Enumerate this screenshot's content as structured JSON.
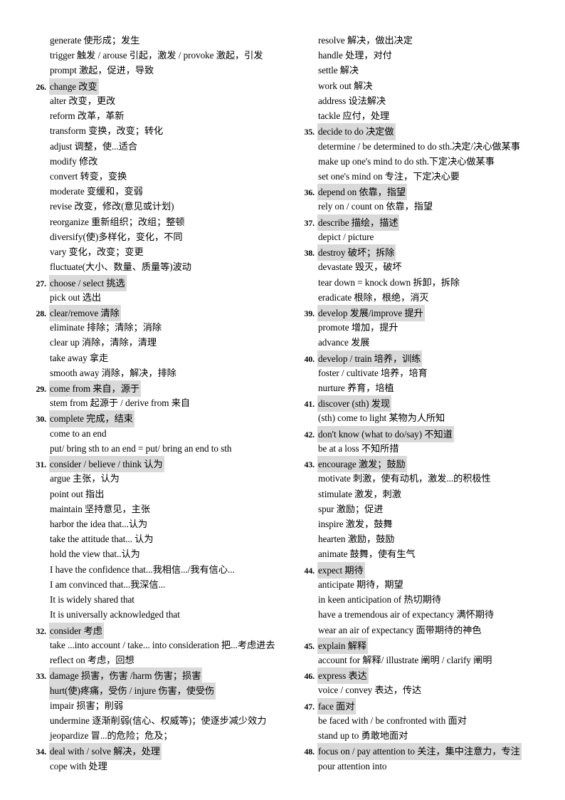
{
  "document": {
    "title": "English Synonym Expressions Vocabulary List",
    "highlight_color": "#d9d9d9",
    "text_color": "#000000",
    "background_color": "#ffffff"
  },
  "left_column": [
    {
      "num": "",
      "text": "generate 使形成；发生",
      "highlight": false
    },
    {
      "num": "",
      "text": "trigger 触发 / arouse 引起，激发 / provoke 激起，引发",
      "highlight": false
    },
    {
      "num": "",
      "text": "prompt 激起，促进，导致",
      "highlight": false
    },
    {
      "num": "26.",
      "text": "change 改变",
      "highlight": true
    },
    {
      "num": "",
      "text": "alter 改变，更改",
      "highlight": false
    },
    {
      "num": "",
      "text": "reform 改革，革新",
      "highlight": false
    },
    {
      "num": "",
      "text": "transform 变换，改变；转化",
      "highlight": false
    },
    {
      "num": "",
      "text": "adjust 调整，使...适合",
      "highlight": false
    },
    {
      "num": "",
      "text": "modify 修改",
      "highlight": false
    },
    {
      "num": "",
      "text": "convert 转变，变换",
      "highlight": false
    },
    {
      "num": "",
      "text": "moderate 变缓和，变弱",
      "highlight": false
    },
    {
      "num": "",
      "text": "revise 改变，修改(意见或计划)",
      "highlight": false
    },
    {
      "num": "",
      "text": "reorganize 重新组织；改组；整顿",
      "highlight": false
    },
    {
      "num": "",
      "text": "diversify(使)多样化，变化，不同",
      "highlight": false
    },
    {
      "num": "",
      "text": "vary 变化，改变；变更",
      "highlight": false
    },
    {
      "num": "",
      "text": "fluctuate(大小、数量、质量等)波动",
      "highlight": false
    },
    {
      "num": "27.",
      "text": "choose / select  挑选",
      "highlight": true
    },
    {
      "num": "",
      "text": "pick out 选出",
      "highlight": false
    },
    {
      "num": "28.",
      "text": "clear/remove 清除",
      "highlight": true
    },
    {
      "num": "",
      "text": "eliminate 排除；清除；消除",
      "highlight": false
    },
    {
      "num": "",
      "text": "clear up 消除，清除，清理",
      "highlight": false
    },
    {
      "num": "",
      "text": "take away 拿走",
      "highlight": false
    },
    {
      "num": "",
      "text": "smooth away 消除，解决，排除",
      "highlight": false
    },
    {
      "num": "29.",
      "text": "come from  来自，源于",
      "highlight": true
    },
    {
      "num": "",
      "text": "stem from 起源于 / derive from 来自",
      "highlight": false
    },
    {
      "num": "30.",
      "text": "complete 完成，结束",
      "highlight": true
    },
    {
      "num": "",
      "text": "come to an end",
      "highlight": false
    },
    {
      "num": "",
      "text": "put/ bring sth to an end = put/ bring an end to sth",
      "highlight": false
    },
    {
      "num": "31.",
      "text": "consider / believe / think 认为",
      "highlight": true
    },
    {
      "num": "",
      "text": "argue 主张，认为",
      "highlight": false
    },
    {
      "num": "",
      "text": "point out 指出",
      "highlight": false
    },
    {
      "num": "",
      "text": "maintain  坚持意见，主张",
      "highlight": false
    },
    {
      "num": "",
      "text": "harbor the idea that...认为",
      "highlight": false
    },
    {
      "num": "",
      "text": "take the attitude that...  认为",
      "highlight": false
    },
    {
      "num": "",
      "text": "hold the view that..认为",
      "highlight": false
    },
    {
      "num": "",
      "text": "I have the confidence  that...我相信.../我有信心...",
      "highlight": false
    },
    {
      "num": "",
      "text": "I am convinced that...我深信...",
      "highlight": false
    },
    {
      "num": "",
      "text": "It is widely shared that",
      "highlight": false
    },
    {
      "num": "",
      "text": "It is universally acknowledged that",
      "highlight": false
    },
    {
      "num": "32.",
      "text": "consider  考虑",
      "highlight": true
    },
    {
      "num": "",
      "text": "take ...into account / take... into consideration  把...考虑进去",
      "highlight": false
    },
    {
      "num": "",
      "text": "reflect on 考虑，回想",
      "highlight": false
    },
    {
      "num": "33.",
      "text": "damage 损害，伤害 /harm 伤害；损害",
      "highlight": true
    },
    {
      "num": "",
      "text": "hurt(使)疼痛，受伤 / injure 伤害，使受伤",
      "highlight": true
    },
    {
      "num": "",
      "text": "impair 损害；削弱",
      "highlight": false
    },
    {
      "num": "",
      "text": "undermine 逐渐削弱(信心、权威等)；使逐步减少效力",
      "highlight": false
    },
    {
      "num": "",
      "text": "jeopardize 冒...的危险；危及；",
      "highlight": false
    },
    {
      "num": "34.",
      "text": "deal with / solve 解决，处理",
      "highlight": true
    },
    {
      "num": "",
      "text": "cope with 处理",
      "highlight": false
    }
  ],
  "right_column": [
    {
      "num": "",
      "text": "resolve  解决，做出决定",
      "highlight": false
    },
    {
      "num": "",
      "text": "handle  处理，对付",
      "highlight": false
    },
    {
      "num": "",
      "text": "settle 解决",
      "highlight": false
    },
    {
      "num": "",
      "text": "work out 解决",
      "highlight": false
    },
    {
      "num": "",
      "text": "address 设法解决",
      "highlight": false
    },
    {
      "num": "",
      "text": "tackle 应付，处理",
      "highlight": false
    },
    {
      "num": "35.",
      "text": "decide to do 决定做",
      "highlight": true
    },
    {
      "num": "",
      "text": "determine / be determined to do sth.决定/决心做某事",
      "highlight": false
    },
    {
      "num": "",
      "text": "make up one's mind to do sth.下定决心做某事",
      "highlight": false
    },
    {
      "num": "",
      "text": "set one's mind on 专注，下定决心要",
      "highlight": false
    },
    {
      "num": "36.",
      "text": "depend on 依靠，指望",
      "highlight": true
    },
    {
      "num": "",
      "text": "rely on / count on 依靠，指望",
      "highlight": false
    },
    {
      "num": "37.",
      "text": "describe   描绘，描述",
      "highlight": true
    },
    {
      "num": "",
      "text": "depict / picture",
      "highlight": false
    },
    {
      "num": "38.",
      "text": "destroy 破坏；拆除",
      "highlight": true
    },
    {
      "num": "",
      "text": "devastate 毁灭，破坏",
      "highlight": false
    },
    {
      "num": "",
      "text": "tear down = knock down 拆卸，拆除",
      "highlight": false
    },
    {
      "num": "",
      "text": "eradicate 根除，根绝，消灭",
      "highlight": false
    },
    {
      "num": "39.",
      "text": "develop 发展/improve 提升",
      "highlight": true
    },
    {
      "num": "",
      "text": "promote 增加，提升",
      "highlight": false
    },
    {
      "num": "",
      "text": "advance 发展",
      "highlight": false
    },
    {
      "num": "40.",
      "text": "develop / train  培养，训练",
      "highlight": true
    },
    {
      "num": "",
      "text": "foster / cultivate  培养，培育",
      "highlight": false
    },
    {
      "num": "",
      "text": "nurture 养育，培植",
      "highlight": false
    },
    {
      "num": "41.",
      "text": "discover (sth) 发现",
      "highlight": true
    },
    {
      "num": "",
      "text": "(sth) come to light  某物为人所知",
      "highlight": false
    },
    {
      "num": "42.",
      "text": "don't know (what to do/say)  不知道",
      "highlight": true
    },
    {
      "num": "",
      "text": "be at a loss  不知所措",
      "highlight": false
    },
    {
      "num": "43.",
      "text": "encourage 激发；鼓励",
      "highlight": true
    },
    {
      "num": "",
      "text": "motivate 刺激，使有动机，激发...的积极性",
      "highlight": false
    },
    {
      "num": "",
      "text": "stimulate 激发，刺激",
      "highlight": false
    },
    {
      "num": "",
      "text": "spur 激励；促进",
      "highlight": false
    },
    {
      "num": "",
      "text": "inspire 激发，鼓舞",
      "highlight": false
    },
    {
      "num": "",
      "text": "hearten 激励，鼓励",
      "highlight": false
    },
    {
      "num": "",
      "text": "animate 鼓舞，使有生气",
      "highlight": false
    },
    {
      "num": "44.",
      "text": "expect 期待",
      "highlight": true
    },
    {
      "num": "",
      "text": "anticipate 期待，期望",
      "highlight": false
    },
    {
      "num": "",
      "text": "in keen anticipation of 热切期待",
      "highlight": false
    },
    {
      "num": "",
      "text": "have a tremendous air of expectancy 满怀期待",
      "highlight": false
    },
    {
      "num": "",
      "text": "wear an air of expectancy 面带期待的神色",
      "highlight": false
    },
    {
      "num": "45.",
      "text": "explain  解释",
      "highlight": true
    },
    {
      "num": "",
      "text": "account for 解释/ illustrate 阐明 / clarify 阐明",
      "highlight": false
    },
    {
      "num": "46.",
      "text": "express  表达",
      "highlight": true
    },
    {
      "num": "",
      "text": "voice / convey 表达，传达",
      "highlight": false
    },
    {
      "num": "47.",
      "text": "face  面对",
      "highlight": true
    },
    {
      "num": "",
      "text": "be faced with / be confronted with  面对",
      "highlight": false
    },
    {
      "num": "",
      "text": "stand up to 勇敢地面对",
      "highlight": false
    },
    {
      "num": "48.",
      "text": "focus on / pay attention to 关注，集中注意力，专注",
      "highlight": true
    },
    {
      "num": "",
      "text": "pour attention into",
      "highlight": false
    }
  ]
}
